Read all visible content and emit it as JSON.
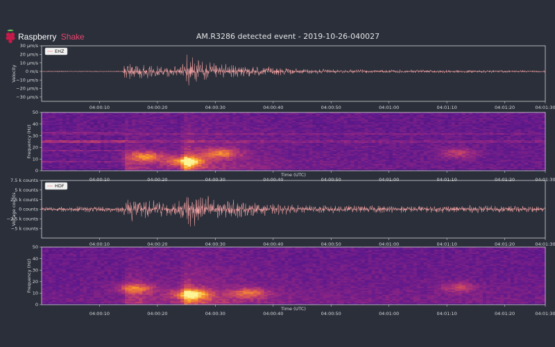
{
  "header": {
    "logo_word1": "Raspberry",
    "logo_word2": "Shake",
    "title": "AM.R3286 detected event - 2019-10-26-040027"
  },
  "colors": {
    "background": "#2a2f3a",
    "trace": "#f0a0a0",
    "logo_red": "#c51a4a",
    "colormap": "inferno/plasma"
  },
  "chart_data": [
    {
      "type": "line",
      "legend": "EHZ",
      "xlabel": "",
      "ylabel": "Velocity",
      "ylim": [
        -35,
        30
      ],
      "yticks": [
        30,
        20,
        10,
        0,
        -10,
        -20,
        -30
      ],
      "ytick_labels": [
        "30 µm/s",
        "20 µm/s",
        "10 µm/s",
        "0 m/s",
        "−10 µm/s",
        "−20 µm/s",
        "−30 µm/s"
      ],
      "xlim": [
        0,
        87
      ],
      "xticks": [
        10,
        20,
        30,
        40,
        50,
        60,
        70,
        80,
        87
      ],
      "xtick_labels": [
        "04:00:10",
        "04:00:20",
        "04:00:30",
        "04:00:40",
        "04:00:50",
        "04:01:00",
        "04:01:10",
        "04:01:20",
        "04:01:30"
      ],
      "envelope": [
        {
          "t": 0,
          "a": 0.5
        },
        {
          "t": 14,
          "a": 0.5
        },
        {
          "t": 14.3,
          "a": 12
        },
        {
          "t": 16,
          "a": 10
        },
        {
          "t": 20,
          "a": 7
        },
        {
          "t": 24,
          "a": 6
        },
        {
          "t": 25,
          "a": 24
        },
        {
          "t": 27,
          "a": 14
        },
        {
          "t": 30,
          "a": 10
        },
        {
          "t": 35,
          "a": 8
        },
        {
          "t": 45,
          "a": 3
        },
        {
          "t": 60,
          "a": 2
        },
        {
          "t": 70,
          "a": 2
        },
        {
          "t": 87,
          "a": 1
        }
      ]
    },
    {
      "type": "heatmap",
      "xlabel": "Time (UTC)",
      "ylabel": "Frequency (Hz)",
      "ylim": [
        0,
        50
      ],
      "yticks": [
        0,
        10,
        20,
        30,
        40,
        50
      ],
      "xlim": [
        0,
        87
      ],
      "xticks": [
        10,
        20,
        30,
        40,
        50,
        60,
        70,
        80,
        87
      ],
      "xtick_labels": [
        "04:00:10",
        "04:00:20",
        "04:00:30",
        "04:00:40",
        "04:00:50",
        "04:01:00",
        "04:01:10",
        "04:01:20",
        "04:01:30"
      ],
      "hot_spots": [
        {
          "t": 25,
          "f": 8,
          "intensity": 1.0
        },
        {
          "t": 18,
          "f": 12,
          "intensity": 0.8
        },
        {
          "t": 31,
          "f": 15,
          "intensity": 0.75
        },
        {
          "t": 72,
          "f": 15,
          "intensity": 0.5
        }
      ]
    },
    {
      "type": "line",
      "legend": "HDF",
      "xlabel": "",
      "ylabel": "Voltage counts",
      "ylim": [
        -7500,
        7500
      ],
      "yticks": [
        7500,
        5000,
        2500,
        0,
        -2500,
        -5000
      ],
      "ytick_labels": [
        "7.5 k counts",
        "5 k counts",
        "2.5 k counts",
        "0 counts",
        "−2.5 k counts",
        "−5 k counts"
      ],
      "xlim": [
        0,
        87
      ],
      "xticks": [
        10,
        20,
        30,
        40,
        50,
        60,
        70,
        80,
        87
      ],
      "xtick_labels": [
        "04:00:10",
        "04:00:20",
        "04:00:30",
        "04:00:40",
        "04:00:50",
        "04:01:00",
        "04:01:10",
        "04:01:20",
        "04:01:30"
      ],
      "envelope": [
        {
          "t": 0,
          "a": 700
        },
        {
          "t": 14,
          "a": 900
        },
        {
          "t": 15,
          "a": 3500
        },
        {
          "t": 18,
          "a": 2800
        },
        {
          "t": 22,
          "a": 2000
        },
        {
          "t": 24,
          "a": 2500
        },
        {
          "t": 25,
          "a": 6000
        },
        {
          "t": 28,
          "a": 4000
        },
        {
          "t": 31,
          "a": 3000
        },
        {
          "t": 36,
          "a": 2000
        },
        {
          "t": 45,
          "a": 1200
        },
        {
          "t": 60,
          "a": 1000
        },
        {
          "t": 74,
          "a": 1100
        },
        {
          "t": 87,
          "a": 800
        }
      ]
    },
    {
      "type": "heatmap",
      "xlabel": "Time (UTC)",
      "ylabel": "Frequency (Hz)",
      "ylim": [
        0,
        50
      ],
      "yticks": [
        0,
        10,
        20,
        30,
        40,
        50
      ],
      "xlim": [
        0,
        87
      ],
      "xticks": [
        10,
        20,
        30,
        40,
        50,
        60,
        70,
        80,
        87
      ],
      "xtick_labels": [
        "04:00:10",
        "04:00:20",
        "04:00:30",
        "04:00:40",
        "04:00:50",
        "04:01:00",
        "04:01:10",
        "04:01:20",
        "04:01:30"
      ],
      "hot_spots": [
        {
          "t": 26,
          "f": 9,
          "intensity": 0.95
        },
        {
          "t": 16,
          "f": 14,
          "intensity": 0.7
        },
        {
          "t": 36,
          "f": 10,
          "intensity": 0.65
        },
        {
          "t": 72,
          "f": 15,
          "intensity": 0.45
        }
      ]
    }
  ]
}
